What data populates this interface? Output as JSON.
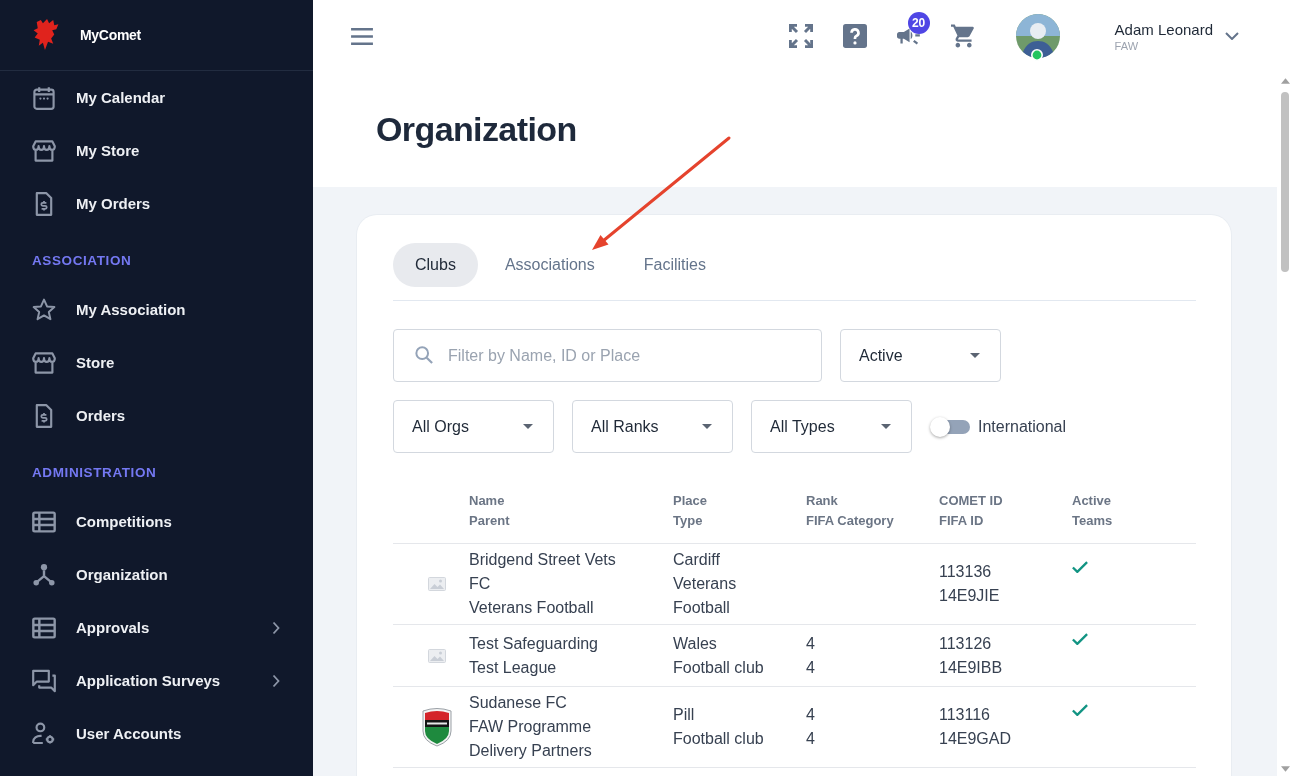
{
  "sidebar": {
    "brand": "MyComet",
    "sections": [
      {
        "items": [
          {
            "label": "My Calendar",
            "selected": false,
            "submenu": false
          },
          {
            "label": "My Store",
            "selected": false,
            "submenu": false
          },
          {
            "label": "My Orders",
            "selected": false,
            "submenu": false
          }
        ]
      },
      {
        "heading": "ASSOCIATION",
        "items": [
          {
            "label": "My Association",
            "selected": false,
            "submenu": false
          },
          {
            "label": "Store",
            "selected": false,
            "submenu": false
          },
          {
            "label": "Orders",
            "selected": false,
            "submenu": false
          }
        ]
      },
      {
        "heading": "ADMINISTRATION",
        "items": [
          {
            "label": "Competitions",
            "selected": false,
            "submenu": false
          },
          {
            "label": "Organization",
            "selected": false,
            "submenu": false
          },
          {
            "label": "Approvals",
            "selected": false,
            "submenu": true
          },
          {
            "label": "Application Surveys",
            "selected": false,
            "submenu": true
          },
          {
            "label": "User Accounts",
            "selected": false,
            "submenu": false
          }
        ]
      }
    ]
  },
  "header": {
    "notifications": "20",
    "user": {
      "name": "Adam Leonard",
      "org": "FAW",
      "online": true
    }
  },
  "page": {
    "title": "Organization"
  },
  "tabs": [
    {
      "label": "Clubs",
      "selected": true
    },
    {
      "label": "Associations",
      "selected": false
    },
    {
      "label": "Facilities",
      "selected": false
    }
  ],
  "filters": {
    "search": {
      "placeholder": "Filter by Name, ID or Place"
    },
    "status": "Active",
    "dropdowns": [
      "All Orgs",
      "All Ranks",
      "All Types"
    ],
    "international": {
      "label": "International",
      "on": false
    }
  },
  "table": {
    "columns": [
      {
        "title": "Name",
        "subtitle": "Parent"
      },
      {
        "title": "Place",
        "subtitle": "Type"
      },
      {
        "title": "Rank",
        "subtitle": "FIFA Category"
      },
      {
        "title": "COMET ID",
        "subtitle": "FIFA ID"
      },
      {
        "title": "Active",
        "subtitle": "Teams"
      }
    ],
    "rows": [
      {
        "logo": {
          "kind": "placeholder"
        },
        "name": "Bridgend Street Vets FC",
        "parent": "Veterans Football",
        "place": "Cardiff",
        "type": "Veterans Football",
        "comet_id": "113136",
        "fifa_id": "14E9JIE",
        "active": true
      },
      {
        "logo": {
          "kind": "placeholder"
        },
        "name": "Test Safeguarding",
        "parent": "Test League",
        "place": "Wales",
        "type": "Football club",
        "rank": "4",
        "fifa_category": "4",
        "comet_id": "113126",
        "fifa_id": "14E9IBB",
        "active": true
      },
      {
        "logo": {
          "kind": "crest"
        },
        "name": "Sudanese FC",
        "parent": "FAW Programme Delivery Partners",
        "place": "Pill",
        "type": "Football club",
        "rank": "4",
        "fifa_category": "4",
        "comet_id": "113116",
        "fifa_id": "14E9GAD",
        "active": true
      }
    ]
  }
}
